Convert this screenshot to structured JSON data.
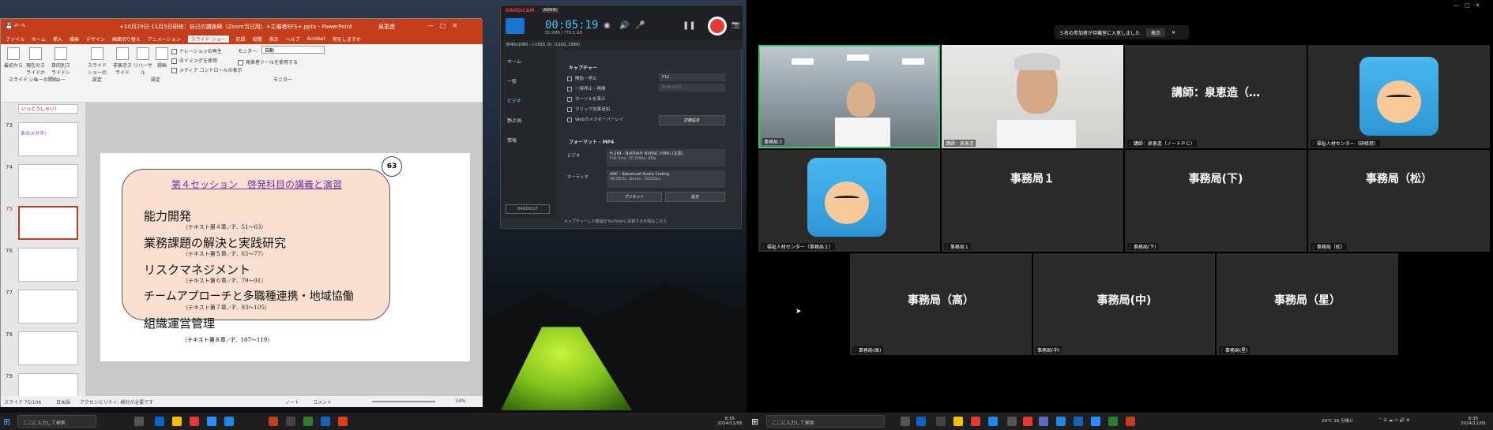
{
  "ppt": {
    "title": "+10月29日-11月5日研修：自己の講座師（Zoom当日用）+主催者EFS+.pptx - PowerPoint",
    "user": "泉恵造",
    "tabs": [
      "ファイル",
      "ホーム",
      "挿入",
      "描画",
      "デザイン",
      "画面切り替え",
      "アニメーション",
      "スライド ショー",
      "記録",
      "校閲",
      "表示",
      "ヘルプ",
      "Acrobat",
      "何をしますか"
    ],
    "active_tab": "スライド ショー",
    "ribbon": {
      "from_start": "最初から",
      "from_current": "現在のスライドから",
      "custom": "目的別スライドショー",
      "setup": "スライドショーの設定",
      "hide": "非表示スライド",
      "rehearse": "リハーサル",
      "record": "録画",
      "narration": "ナレーションの再生",
      "timing": "タイミングを使用",
      "media": "メディア コントロールの表示",
      "monitor_label": "モニター:",
      "monitor_value": "自動",
      "presenter_view": "発表者ツールを使用する",
      "group_start": "スライド ショーの開始",
      "group_setup": "設定",
      "group_monitor": "モニター"
    },
    "thumb_top_text": "いっとうしゃい！",
    "thumbnails": [
      {
        "num": "73",
        "text": "あのメガネ!"
      },
      {
        "num": "74",
        "text": ""
      },
      {
        "num": "75",
        "text": ""
      },
      {
        "num": "76",
        "text": ""
      },
      {
        "num": "77",
        "text": ""
      },
      {
        "num": "78",
        "text": ""
      },
      {
        "num": "79",
        "text": ""
      }
    ],
    "slide": {
      "title": "第４セッション　啓発科目の講義と演習",
      "number": "63",
      "topics": [
        {
          "text": "能力開発",
          "ref": "（テキスト第４章／P．51〜63）"
        },
        {
          "text": "業務課題の解決と実践研究",
          "ref": "（テキスト第５章／P．65〜77）"
        },
        {
          "text": "リスクマネジメント",
          "ref": "（テキスト第６章／P．79〜91）"
        },
        {
          "text": "チームアプローチと多職種連携・地域協働",
          "ref": "（テキスト第７章／P．93〜105）"
        },
        {
          "text": "組織運営管理",
          "ref": "（テキスト第８章／P．107〜119）"
        }
      ]
    },
    "status": {
      "slide": "スライド 75/106",
      "lang": "日本語",
      "access": "アクセシビリティ: 検討が必要です",
      "notes": "ノート",
      "comments": "コメント",
      "zoom": "74%"
    }
  },
  "bandicam": {
    "brand": "BANDICAM",
    "badge": "ADMIN",
    "timer": "00:05:19",
    "size": "55.5MB / 770.5 GB",
    "mode": "3840x1080 - (-1920, 0), (1920, 1080)",
    "nav": [
      "ホーム",
      "一般",
      "ビデオ",
      "静止画",
      "情報"
    ],
    "capture_title": "キャプチャー",
    "capture_options": [
      {
        "label": "開始・停止",
        "checked": true,
        "key": "F12"
      },
      {
        "label": "一時停止・再開",
        "checked": false,
        "key": "Shift+F12"
      },
      {
        "label": "カーソルを表示",
        "checked": true,
        "key": ""
      },
      {
        "label": "クリック効果追加",
        "checked": false,
        "key": ""
      },
      {
        "label": "Webカメラオーバーレイ",
        "checked": false,
        "key": ""
      }
    ],
    "detail_btn": "詳細設定",
    "format_title": "フォーマット - MP4",
    "video_label": "ビデオ",
    "video_value": "H.264 - NVIDIA® NVENC (VBR) (注意)",
    "video_sub": "Full Size, 30.00fps, 80q",
    "audio_label": "オーディオ",
    "audio_value": "AAC - Advanced Audio Coding",
    "audio_sub": "48.0KHz, stereo, 192kbps",
    "preset_btn": "プリセット",
    "settings_btn": "設定",
    "bandicut": "BANDICUT",
    "footer": "キャプチャーした動画をYouTubeに投稿する手順はこちら"
  },
  "zoom": {
    "notice": "５名の参加者が待機室に入室しました",
    "notice_btn": "表示",
    "tiles": [
      {
        "name": "事務局３",
        "big": "",
        "type": "cam1"
      },
      {
        "name": "講師：泉恵造",
        "big": "",
        "type": "cam2"
      },
      {
        "name": "講師：泉恵造（ノートＰＣ）",
        "big": "講師：泉恵造（…",
        "type": "text"
      },
      {
        "name": "福祉人材センター（研修用）",
        "big": "",
        "type": "avatar"
      },
      {
        "name": "福祉人材センター（事務局２）",
        "big": "",
        "type": "avatar"
      },
      {
        "name": "事務局１",
        "big": "事務局１",
        "type": "text"
      },
      {
        "name": "事務局(下)",
        "big": "事務局(下)",
        "type": "text"
      },
      {
        "name": "事務局（松）",
        "big": "事務局（松）",
        "type": "text"
      },
      {
        "name": "事務局(高)",
        "big": "事務局（高）",
        "type": "text"
      },
      {
        "name": "事務局(中)",
        "big": "事務局(中)",
        "type": "text"
      },
      {
        "name": "事務局(星)",
        "big": "事務局（星）",
        "type": "text"
      }
    ]
  },
  "taskbar_left": {
    "search": "ここに入力して検索",
    "time": "8:35",
    "date": "2024/11/05"
  },
  "taskbar_right": {
    "search": "ここに入力して検索",
    "weather": "29°C 16 分後に",
    "time": "8:35",
    "date": "2024/11/05"
  }
}
